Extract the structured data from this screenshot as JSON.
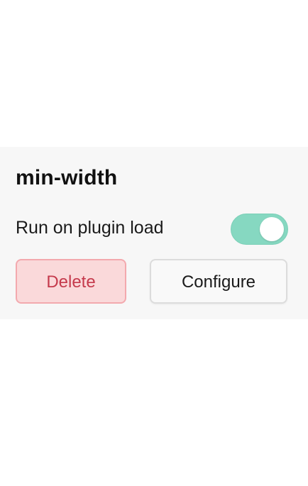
{
  "panel": {
    "title": "min-width",
    "setting": {
      "label": "Run on plugin load",
      "toggle_on": true
    },
    "buttons": {
      "delete_label": "Delete",
      "configure_label": "Configure"
    }
  },
  "colors": {
    "panel_bg": "#f7f7f7",
    "toggle_on": "#86d8c1",
    "delete_bg": "#fad9da",
    "delete_text": "#c53a4c"
  }
}
